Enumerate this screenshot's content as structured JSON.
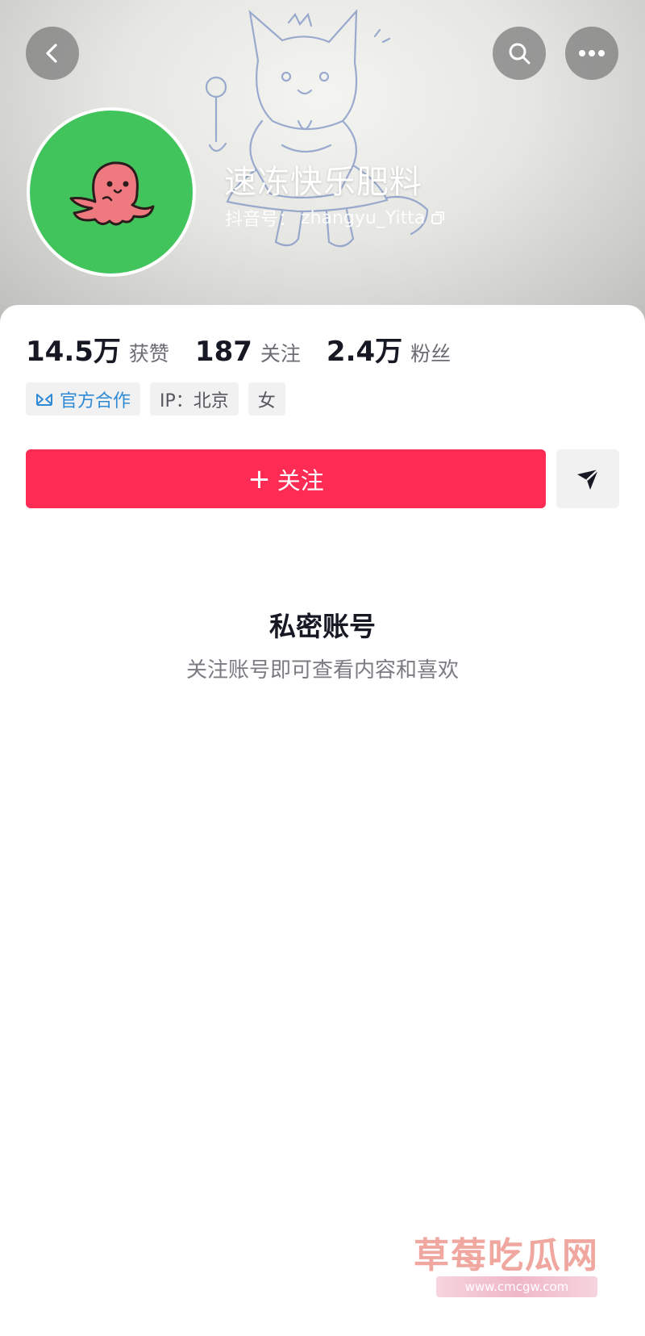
{
  "profile": {
    "display_name": "速冻快乐肥料",
    "id_label": "抖音号：",
    "id_value": "zhangyu_Yitta"
  },
  "stats": [
    {
      "value": "14.5万",
      "label": "获赞"
    },
    {
      "value": "187",
      "label": "关注"
    },
    {
      "value": "2.4万",
      "label": "粉丝"
    }
  ],
  "tags": {
    "official": "官方合作",
    "ip": "IP：北京",
    "gender": "女"
  },
  "actions": {
    "follow_plus": "+",
    "follow_label": "关注"
  },
  "private": {
    "title": "私密账号",
    "description": "关注账号即可查看内容和喜欢"
  },
  "watermark": {
    "text": "草莓吃瓜网",
    "url": "www.cmcgw.com"
  },
  "colors": {
    "accent": "#fe2c55",
    "avatar_bg": "#41c45b",
    "official_blue": "#2f8ad6"
  }
}
